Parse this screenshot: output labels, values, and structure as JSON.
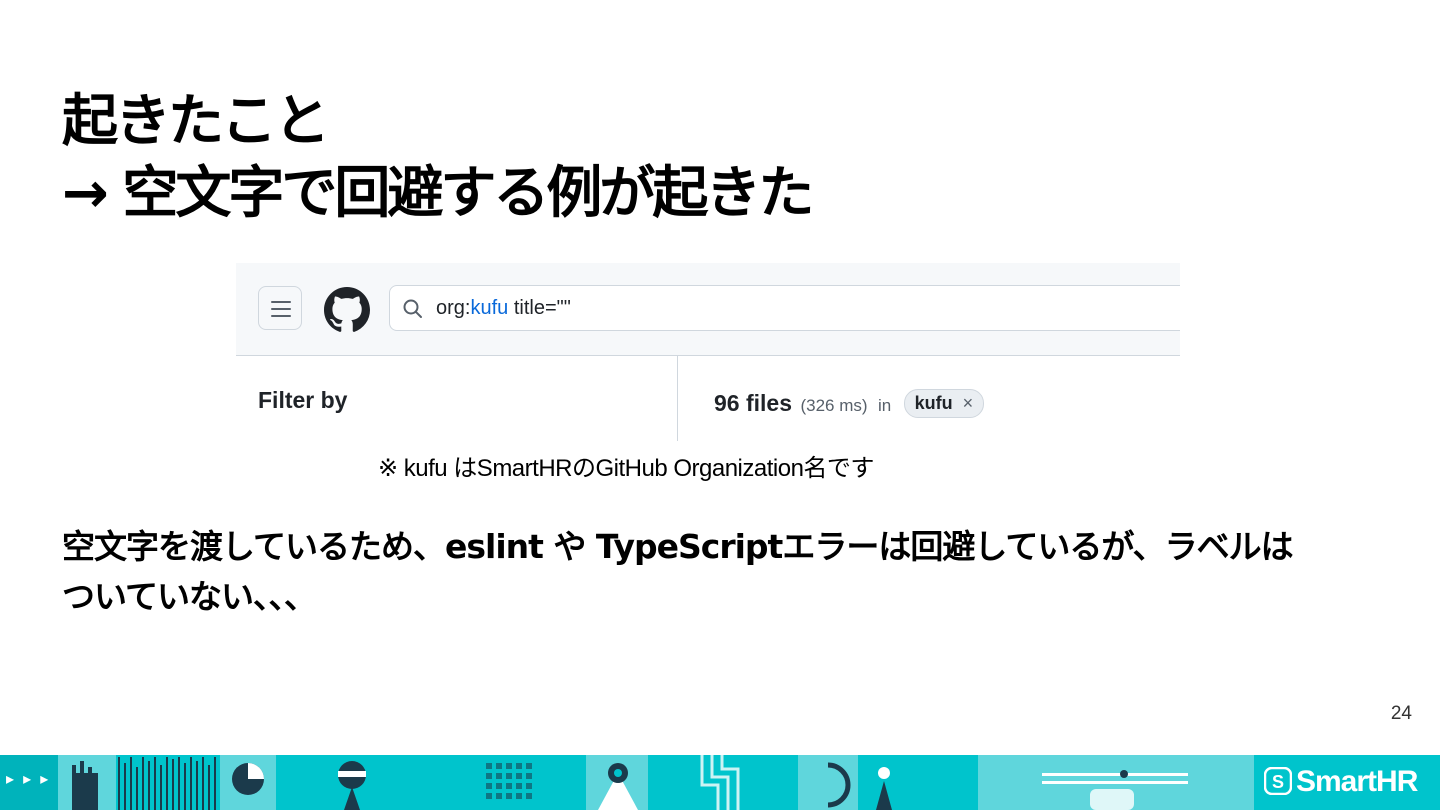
{
  "slide": {
    "title_line1": "起きたこと",
    "title_line2": "→ 空文字で回避する例が起きた",
    "note": "※ kufu はSmartHRのGitHub Organization名です",
    "body_line1": "空文字を渡しているため、eslint や TypeScriptエラーは回避しているが、ラベルは",
    "body_line2": "ついていない、、、",
    "page_number": "24"
  },
  "github": {
    "search_query_prefix": "org:",
    "search_query_org": "kufu",
    "search_query_suffix": " title=\"\"",
    "filter_label": "Filter by",
    "result_count": "96 files",
    "result_time": "(326 ms)",
    "result_in": "in",
    "org_chip": "kufu",
    "chip_close": "×",
    "icons": [
      "menu-icon",
      "github-logo-icon",
      "search-icon",
      "close-icon"
    ]
  },
  "footer": {
    "brand": "SmartHR",
    "arrows": "▸ ▸ ▸",
    "colors": {
      "teal": "#00c4cc",
      "light_teal": "#5fd6dc",
      "dark": "#1b3a4b"
    }
  }
}
